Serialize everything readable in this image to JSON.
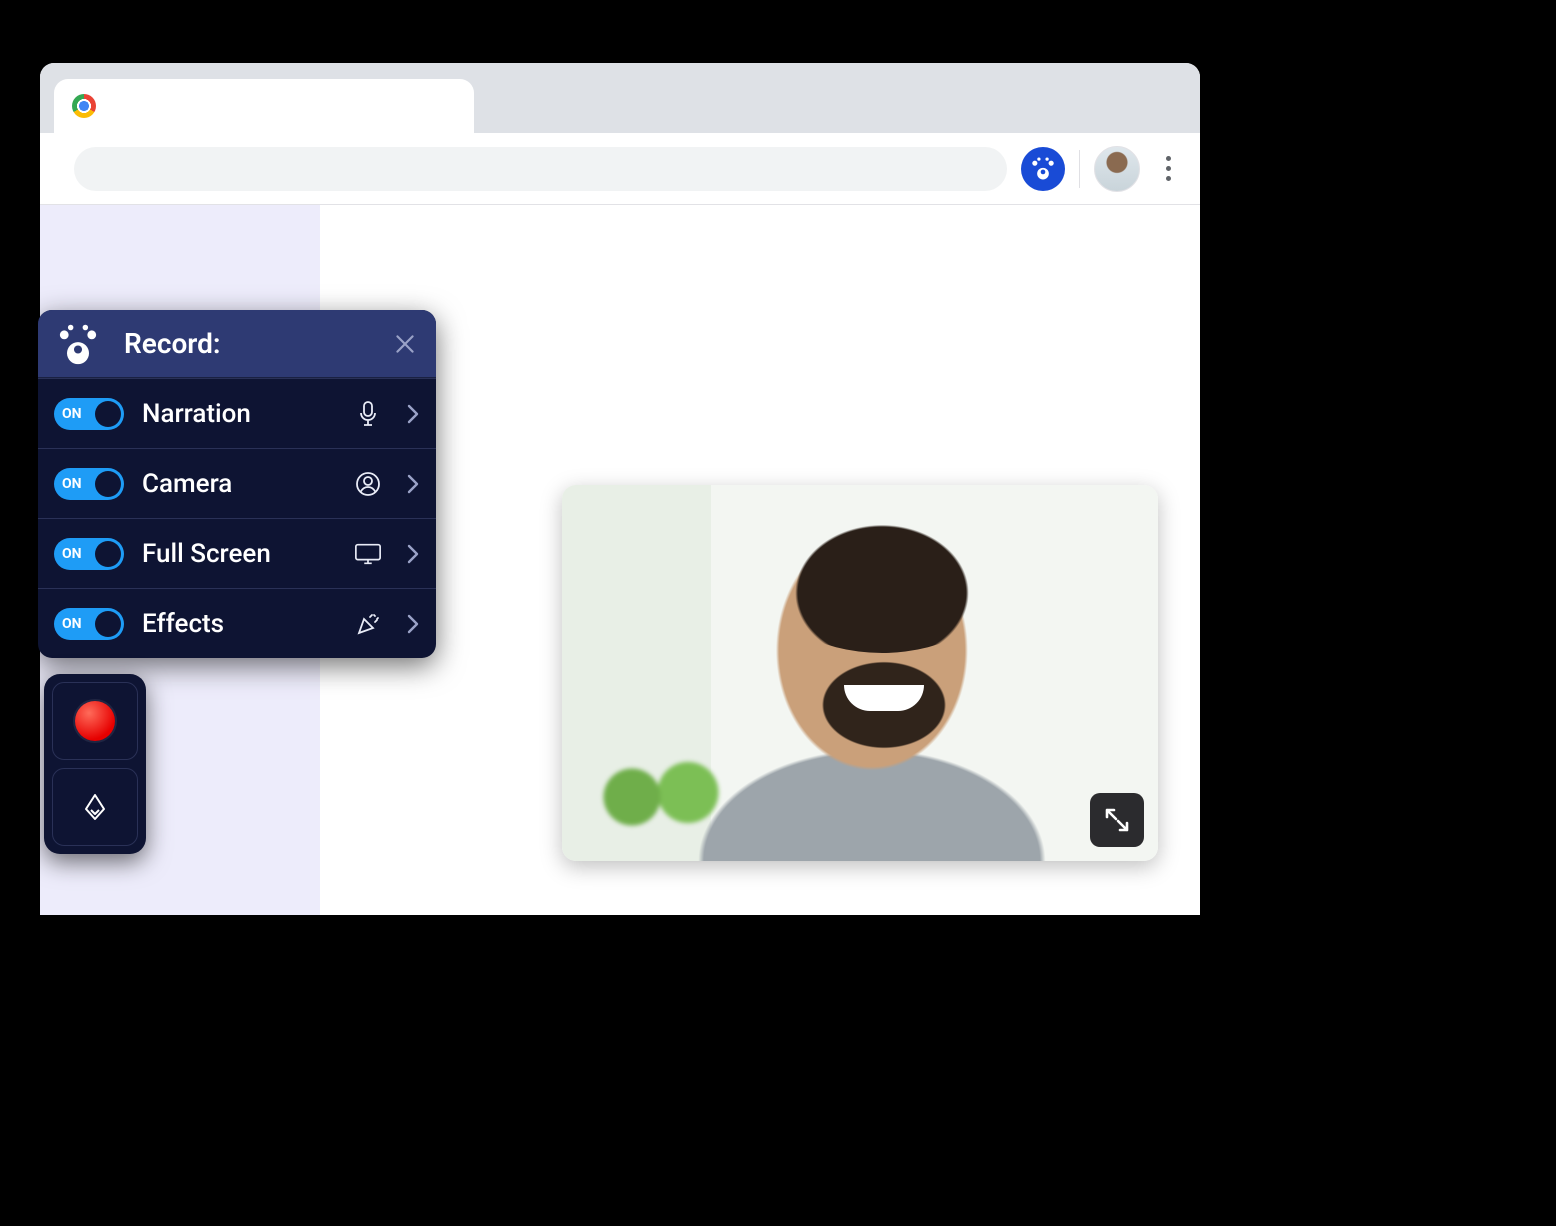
{
  "panel": {
    "title": "Record:",
    "toggle_on_label": "ON",
    "items": [
      {
        "label": "Narration",
        "icon": "microphone-icon",
        "on": true
      },
      {
        "label": "Camera",
        "icon": "user-circle-icon",
        "on": true
      },
      {
        "label": "Full Screen",
        "icon": "monitor-icon",
        "on": true
      },
      {
        "label": "Effects",
        "icon": "confetti-icon",
        "on": true
      }
    ]
  },
  "colors": {
    "accent": "#1e9cf6",
    "panel": "#0e1433",
    "header": "#2e3a73"
  }
}
